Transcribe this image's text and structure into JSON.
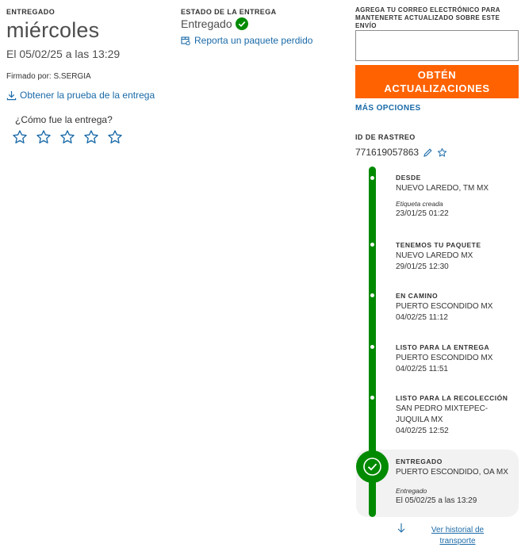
{
  "delivery": {
    "label": "ENTREGADO",
    "day": "miércoles",
    "date_text": "El 05/02/25 a las 13:29",
    "signed_by": "Firmado por: S.SERGIA",
    "proof_link": "Obtener la prueba de la entrega",
    "rating_question": "¿Cómo fue la entrega?",
    "rating_stars_total": 5,
    "rating_value": 0
  },
  "status": {
    "label": "ESTADO DE LA ENTREGA",
    "value": "Entregado",
    "lost_package_link": "Reporta un paquete perdido"
  },
  "updates": {
    "email_label": "AGREGA TU CORREO ELECTRÓNICO PARA MANTENERTE ACTUALIZADO SOBRE ESTE ENVÍO",
    "email_value": "",
    "button_label": "OBTÉN ACTUALIZACIONES",
    "more_options": "MÁS OPCIONES"
  },
  "tracking": {
    "label": "ID DE RASTREO",
    "number": "771619057863"
  },
  "timeline": {
    "events": [
      {
        "title": "DESDE",
        "location": "NUEVO LAREDO, TM MX",
        "note": "Etiqueta creada",
        "datetime": "23/01/25 01:22"
      },
      {
        "title": "TENEMOS TU PAQUETE",
        "location": "NUEVO LAREDO MX",
        "datetime": "29/01/25 12:30"
      },
      {
        "title": "EN CAMINO",
        "location": "PUERTO ESCONDIDO MX",
        "datetime": "04/02/25 11:12"
      },
      {
        "title": "LISTO PARA LA ENTREGA",
        "location": "PUERTO ESCONDIDO MX",
        "datetime": "04/02/25 11:51"
      },
      {
        "title": "LISTO PARA LA RECOLECCIÓN",
        "location": "SAN PEDRO MIXTEPEC-JUQUILA MX",
        "datetime": "04/02/25 12:52"
      },
      {
        "title": "ENTREGADO",
        "location": "PUERTO ESCONDIDO, OA MX",
        "note": "Entregado",
        "datetime": "El 05/02/25 a las 13:29"
      }
    ],
    "history_link": "Ver historial de transporte"
  },
  "colors": {
    "accent_orange": "#ff6200",
    "success_green": "#008a00",
    "link_blue": "#1a6aa8"
  },
  "icons": {
    "download": "download-icon",
    "check": "check-circle-icon",
    "package_report": "package-icon",
    "star": "star-outline-icon",
    "edit": "pencil-icon",
    "favorite": "star-outline-icon",
    "history": "arrow-down-icon"
  }
}
